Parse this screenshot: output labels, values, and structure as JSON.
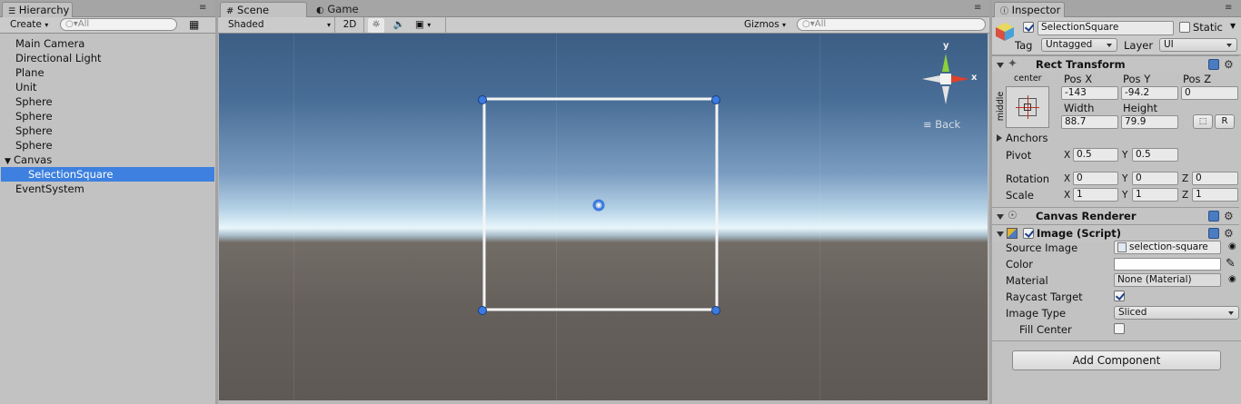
{
  "hierarchy": {
    "tab_label": "Hierarchy",
    "create_label": "Create",
    "search_placeholder": "All",
    "items": [
      {
        "label": "Main Camera"
      },
      {
        "label": "Directional Light"
      },
      {
        "label": "Plane"
      },
      {
        "label": "Unit"
      },
      {
        "label": "Sphere"
      },
      {
        "label": "Sphere"
      },
      {
        "label": "Sphere"
      },
      {
        "label": "Sphere"
      },
      {
        "label": "Canvas"
      },
      {
        "label": "SelectionSquare"
      },
      {
        "label": "EventSystem"
      }
    ]
  },
  "scene": {
    "tab_scene": "Scene",
    "tab_game": "Game",
    "shading_mode": "Shaded",
    "mode_2d": "2D",
    "gizmos_label": "Gizmos",
    "search_placeholder": "All",
    "gizmo_y": "y",
    "gizmo_x": "x",
    "back_label": "Back"
  },
  "inspector": {
    "tab_label": "Inspector",
    "object_name": "SelectionSquare",
    "static_label": "Static",
    "tag_label": "Tag",
    "tag_value": "Untagged",
    "layer_label": "Layer",
    "layer_value": "UI",
    "rect_transform": {
      "title": "Rect Transform",
      "anchor_preset_h": "center",
      "anchor_preset_v": "middle",
      "pos_x_label": "Pos X",
      "pos_x": "-143",
      "pos_y_label": "Pos Y",
      "pos_y": "-94.2",
      "pos_z_label": "Pos Z",
      "pos_z": "0",
      "width_label": "Width",
      "width": "88.7",
      "height_label": "Height",
      "height": "79.9",
      "r_button": "R",
      "anchors_label": "Anchors",
      "pivot_label": "Pivot",
      "pivot_x": "0.5",
      "pivot_y": "0.5",
      "rotation_label": "Rotation",
      "rot_x": "0",
      "rot_y": "0",
      "rot_z": "0",
      "scale_label": "Scale",
      "scale_x": "1",
      "scale_y": "1",
      "scale_z": "1",
      "x_label": "X",
      "y_label": "Y",
      "z_label": "Z"
    },
    "canvas_renderer": {
      "title": "Canvas Renderer"
    },
    "image_script": {
      "title": "Image (Script)",
      "source_image_label": "Source Image",
      "source_image_value": "selection-square",
      "color_label": "Color",
      "color_value": "#ffffff",
      "material_label": "Material",
      "material_value": "None (Material)",
      "raycast_label": "Raycast Target",
      "raycast_checked": true,
      "image_type_label": "Image Type",
      "image_type_value": "Sliced",
      "fill_center_label": "Fill Center",
      "fill_center_checked": false
    },
    "add_component_label": "Add Component"
  },
  "colors": {
    "selection": "#3d80df",
    "panel_bg": "#c2c2c2",
    "handle": "#3b7ae0"
  }
}
